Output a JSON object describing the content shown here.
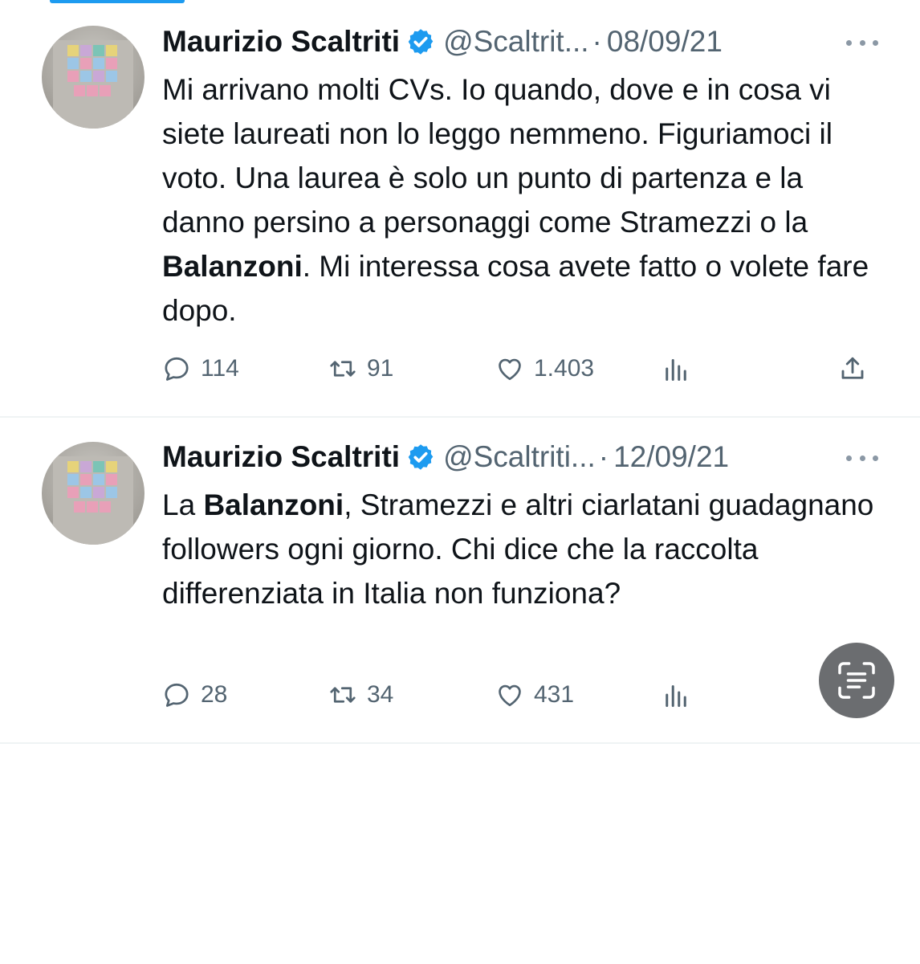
{
  "tweets": [
    {
      "author_name": "Maurizio Scaltriti",
      "handle": "@Scaltrit...",
      "separator": "·",
      "date": "08/09/21",
      "text_parts": [
        "Mi arrivano molti CVs. Io quando, dove e in cosa vi siete laureati non lo leggo nemmeno. Figuriamoci il voto. Una laurea è solo un punto di partenza e la danno persino a personaggi come Stramezzi o la ",
        "Balanzoni",
        ". Mi interessa cosa avete fatto o volete fare dopo."
      ],
      "replies": "114",
      "retweets": "91",
      "likes": "1.403"
    },
    {
      "author_name": "Maurizio Scaltriti",
      "handle": "@Scaltriti...",
      "separator": "·",
      "date": "12/09/21",
      "text_parts": [
        "La ",
        "Balanzoni",
        ", Stramezzi e altri ciarlatani guadagnano followers ogni giorno. Chi dice che la raccolta differenziata in Italia non funziona?"
      ],
      "replies": "28",
      "retweets": "34",
      "likes": "431"
    }
  ],
  "icons": {
    "verified": "verified-badge-icon",
    "more": "more-options-icon",
    "reply": "reply-icon",
    "retweet": "retweet-icon",
    "like": "heart-icon",
    "views": "views-icon",
    "share": "share-icon",
    "lens": "text-scan-icon"
  },
  "colors": {
    "accent": "#1d9bf0",
    "text": "#0f1419",
    "secondary": "#536471",
    "divider": "#eff3f4",
    "lens_button": "#6b6d70"
  }
}
